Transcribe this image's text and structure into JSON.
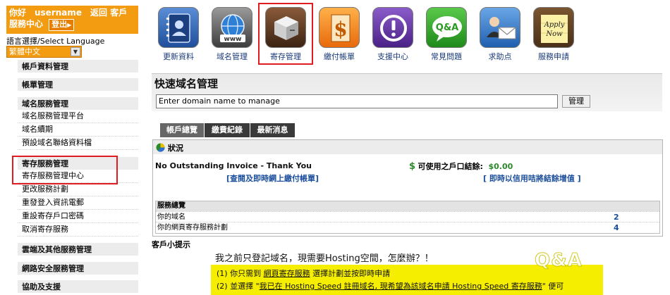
{
  "sidebar": {
    "greeting_line1": "你好　username　返回 客戶",
    "greeting_line2": "服務中心",
    "logout_label": "登出",
    "lang_label": "語言選擇/Select Language",
    "lang_selected": "繁體中文",
    "sections": [
      {
        "label": "帳戶資料管理",
        "items": []
      },
      {
        "label": "帳單管理",
        "items": []
      },
      {
        "label": "域名服務管理",
        "items": [
          "域名服務管理平台",
          "域名續期",
          "預設域名聯絡資料檔"
        ]
      },
      {
        "label": "寄存服務管理",
        "items": [
          "寄存服務管理中心",
          "更改服務計劃",
          "重發登入資訊電郵",
          "重設寄存戶口密碼",
          "取消寄存服務"
        ]
      },
      {
        "label": "雲端及其他服務管理",
        "items": []
      },
      {
        "label": "網路安全服務管理",
        "items": []
      },
      {
        "label": "協助及支援",
        "items": []
      }
    ]
  },
  "iconbar": {
    "items": [
      {
        "label": "更新資料",
        "icon": "address-book-icon"
      },
      {
        "label": "域名管理",
        "icon": "globe-www-icon"
      },
      {
        "label": "寄存管理",
        "icon": "server-box-icon"
      },
      {
        "label": "繳付帳單",
        "icon": "dollar-bill-icon"
      },
      {
        "label": "支援中心",
        "icon": "alert-icon"
      },
      {
        "label": "常見問題",
        "icon": "qa-bubble-icon"
      },
      {
        "label": "求助点",
        "icon": "mail-person-icon"
      },
      {
        "label": "服務申請",
        "icon": "apply-now-icon"
      }
    ]
  },
  "quick": {
    "title": "快速域名管理",
    "input_value": "Enter domain name to manage",
    "button_label": "管理"
  },
  "tabs": [
    "帳戶總覽",
    "繳費紀錄",
    "最新消息"
  ],
  "overview": {
    "status_title": "狀況",
    "no_invoice": "No Outstanding Invoice - Thank You",
    "credit_label": "可使用之戶口結餘:",
    "credit_amount": "$0.00",
    "pay_link": "[查閱及即時網上繳付帳單]",
    "topup_link": "[ 即時以信用咭將結餘增值 ]",
    "summary_title": "服務總覽",
    "summary_rows": [
      {
        "label": "你的域名",
        "value": "2"
      },
      {
        "label": "你的網頁寄存服務計劃",
        "value": "4"
      }
    ]
  },
  "tips": {
    "title": "客戶小提示",
    "question": "我之前只登記域名，現需要Hosting空間，怎麼辦？！",
    "line1_a": "(1) 你只需到 ",
    "line1_u": "網頁寄存服務",
    "line1_b": " 選擇計劃並按即時申請",
    "line2_a": "(2) 並選擇 \"",
    "line2_u": "我已在 Hosting Speed 註冊域名, 現希望為該域名申請 Hosting Speed 寄存服務",
    "line2_b": "\" 便可",
    "badge": "Q&A"
  },
  "colors": {
    "accent_orange": "#f39c12",
    "highlight_red": "#e01b22",
    "link_blue": "#1b4e9b",
    "tips_yellow": "#f5ee00"
  }
}
